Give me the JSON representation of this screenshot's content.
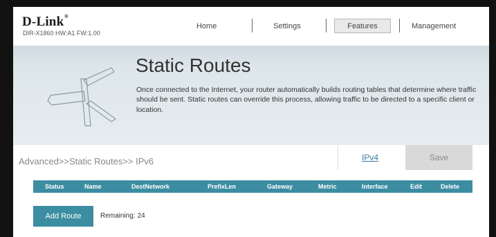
{
  "header": {
    "logo": "D-Link",
    "logo_mark": "®",
    "model": "DIR-X1860 HW:A1 FW:1.00",
    "nav": {
      "home": "Home",
      "settings": "Settings",
      "features": "Features",
      "management": "Management"
    }
  },
  "banner": {
    "title": "Static Routes",
    "description": "Once connected to the Internet, your router automatically builds routing tables that determine where traffic should be sent. Static routes can override this process, allowing traffic to be directed to a specific client or location."
  },
  "breadcrumb": "Advanced>>Static Routes>> IPv6",
  "actions": {
    "ipv4": "IPv4",
    "save": "Save"
  },
  "table": {
    "columns": [
      "Status",
      "Name",
      "DestNetwork",
      "PrefixLen",
      "Gateway",
      "Metric",
      "Interface",
      "Edit",
      "Delete"
    ]
  },
  "add_route": {
    "label": "Add Route",
    "remaining_label": "Remaining:",
    "remaining_value": "24"
  },
  "colors": {
    "accent": "#3c8da2",
    "banner": "#dde6ea",
    "link": "#3a7ba0"
  }
}
